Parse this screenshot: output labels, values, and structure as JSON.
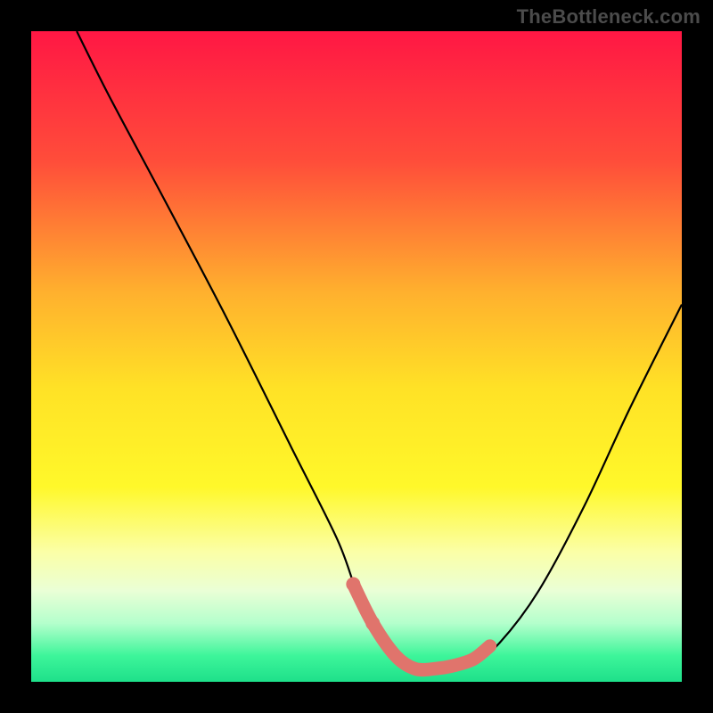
{
  "watermark": "TheBottleneck.com",
  "colors": {
    "bg": "#000000",
    "watermark": "#4b4b4b",
    "curve": "#000000",
    "marker": "#e0746c",
    "gradient_stops": [
      {
        "offset": 0.0,
        "color": "#ff1744"
      },
      {
        "offset": 0.2,
        "color": "#ff4d3a"
      },
      {
        "offset": 0.4,
        "color": "#ffb02e"
      },
      {
        "offset": 0.55,
        "color": "#ffe226"
      },
      {
        "offset": 0.7,
        "color": "#fff82a"
      },
      {
        "offset": 0.8,
        "color": "#fbffa6"
      },
      {
        "offset": 0.86,
        "color": "#eaffd6"
      },
      {
        "offset": 0.91,
        "color": "#b4ffcc"
      },
      {
        "offset": 0.96,
        "color": "#3df59a"
      },
      {
        "offset": 1.0,
        "color": "#1ee08a"
      }
    ]
  },
  "chart_data": {
    "type": "line",
    "title": "",
    "xlabel": "",
    "ylabel": "",
    "xlim": [
      0,
      100
    ],
    "ylim": [
      0,
      100
    ],
    "series": [
      {
        "name": "bottleneck-curve",
        "x": [
          7,
          12,
          20,
          30,
          40,
          47,
          50,
          53,
          56,
          60,
          64,
          68,
          72,
          78,
          85,
          92,
          100
        ],
        "y": [
          100,
          90,
          75,
          56,
          36,
          22,
          14,
          8,
          4,
          2,
          2,
          3,
          6,
          14,
          27,
          42,
          58
        ]
      }
    ],
    "markers": {
      "name": "highlight-dots",
      "x": [
        49.5,
        52.5,
        56,
        59,
        62,
        65,
        68,
        70.5
      ],
      "y": [
        15,
        9,
        4,
        2,
        2,
        2.5,
        3.5,
        5.5
      ]
    }
  }
}
